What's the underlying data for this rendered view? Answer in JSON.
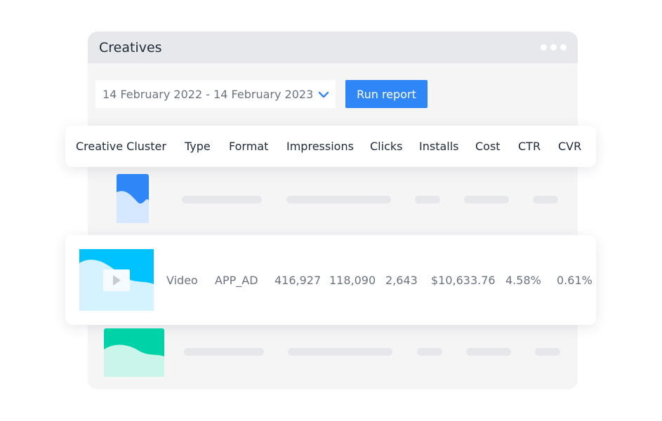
{
  "window": {
    "title": "Creatives"
  },
  "filter": {
    "date_range": "14 February 2022 - 14 February 2023",
    "run_label": "Run report"
  },
  "table": {
    "headers": [
      "Creative Cluster",
      "Type",
      "Format",
      "Impressions",
      "Clicks",
      "Installs",
      "Cost",
      "CTR",
      "CVR"
    ],
    "highlighted_row": {
      "type": "Video",
      "format": "APP_AD",
      "impressions": "416,927",
      "clicks": "118,090",
      "installs": "2,643",
      "cost": "$10,633.76",
      "ctr": "4.58%",
      "cvr": "0.61%"
    }
  },
  "colors": {
    "accent": "#2f86f6",
    "thumb_blue": "#2f86f6",
    "thumb_cyan": "#00c2ff",
    "thumb_teal": "#00d2a8"
  },
  "icons": {
    "dropdown": "chevron-down-icon",
    "window_menu": "more-dots-icon",
    "media": "play-icon"
  }
}
